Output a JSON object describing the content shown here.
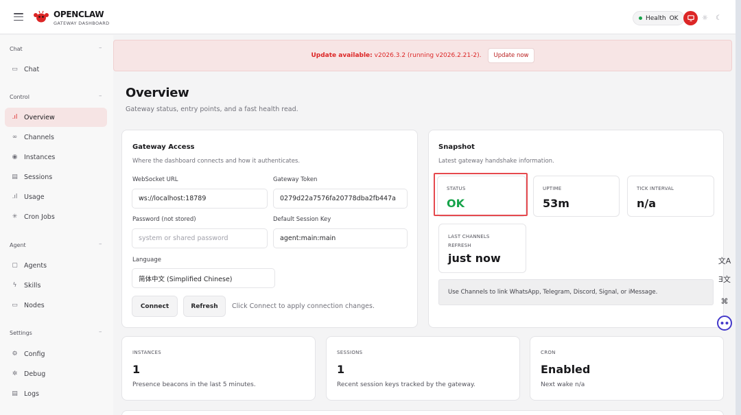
{
  "header": {
    "brand_name": "OPENCLAW",
    "brand_sub": "GATEWAY DASHBOARD",
    "health_label": "Health",
    "health_value": "OK",
    "colors": {
      "accent": "#dc2626",
      "ok": "#16a34a"
    },
    "icons": [
      "menu-icon",
      "lobster-logo-icon",
      "monitor-icon",
      "sun-icon",
      "moon-icon"
    ]
  },
  "sidebar": {
    "groups": [
      {
        "label": "Chat",
        "items": [
          {
            "label": "Chat",
            "icon": "chat-bubble-icon"
          }
        ]
      },
      {
        "label": "Control",
        "items": [
          {
            "label": "Overview",
            "icon": "bar-chart-icon",
            "active": true
          },
          {
            "label": "Channels",
            "icon": "link-icon"
          },
          {
            "label": "Instances",
            "icon": "radio-icon"
          },
          {
            "label": "Sessions",
            "icon": "file-icon"
          },
          {
            "label": "Usage",
            "icon": "bar-chart-icon"
          },
          {
            "label": "Cron Jobs",
            "icon": "spinner-icon"
          }
        ]
      },
      {
        "label": "Agent",
        "items": [
          {
            "label": "Agents",
            "icon": "folder-icon"
          },
          {
            "label": "Skills",
            "icon": "bolt-icon"
          },
          {
            "label": "Nodes",
            "icon": "monitor-icon"
          }
        ]
      },
      {
        "label": "Settings",
        "items": [
          {
            "label": "Config",
            "icon": "gear-icon"
          },
          {
            "label": "Debug",
            "icon": "bug-icon"
          },
          {
            "label": "Logs",
            "icon": "log-icon"
          }
        ]
      }
    ]
  },
  "banner": {
    "title": "Update available:",
    "detail": "v2026.3.2 (running v2026.2.21-2).",
    "button": "Update now"
  },
  "page": {
    "title": "Overview",
    "subtitle": "Gateway status, entry points, and a fast health read."
  },
  "access": {
    "title": "Gateway Access",
    "desc": "Where the dashboard connects and how it authenticates.",
    "ws_label": "WebSocket URL",
    "ws_value": "ws://localhost:18789",
    "token_label": "Gateway Token",
    "token_value": "0279d22a7576fa20778dba2fb447a",
    "password_label": "Password (not stored)",
    "password_placeholder": "system or shared password",
    "session_label": "Default Session Key",
    "session_value": "agent:main:main",
    "language_label": "Language",
    "language_value": "简体中文 (Simplified Chinese)",
    "connect": "Connect",
    "refresh": "Refresh",
    "hint": "Click Connect to apply connection changes."
  },
  "snapshot": {
    "title": "Snapshot",
    "desc": "Latest gateway handshake information.",
    "status_label": "STATUS",
    "status_value": "OK",
    "uptime_label": "UPTIME",
    "uptime_value": "53m",
    "tick_label": "TICK INTERVAL",
    "tick_value": "n/a",
    "refresh_label_1": "LAST CHANNELS",
    "refresh_label_2": "REFRESH",
    "refresh_value": "just now",
    "note": "Use Channels to link WhatsApp, Telegram, Discord, Signal, or iMessage."
  },
  "metrics": [
    {
      "label": "INSTANCES",
      "value": "1",
      "desc": "Presence beacons in the last 5 minutes."
    },
    {
      "label": "SESSIONS",
      "value": "1",
      "desc": "Recent session keys tracked by the gateway."
    },
    {
      "label": "CRON",
      "value": "Enabled",
      "desc": "Next wake n/a"
    }
  ],
  "floating": [
    "translate-icon",
    "translate-alt-icon",
    "command-icon",
    "assistant-face-icon"
  ]
}
